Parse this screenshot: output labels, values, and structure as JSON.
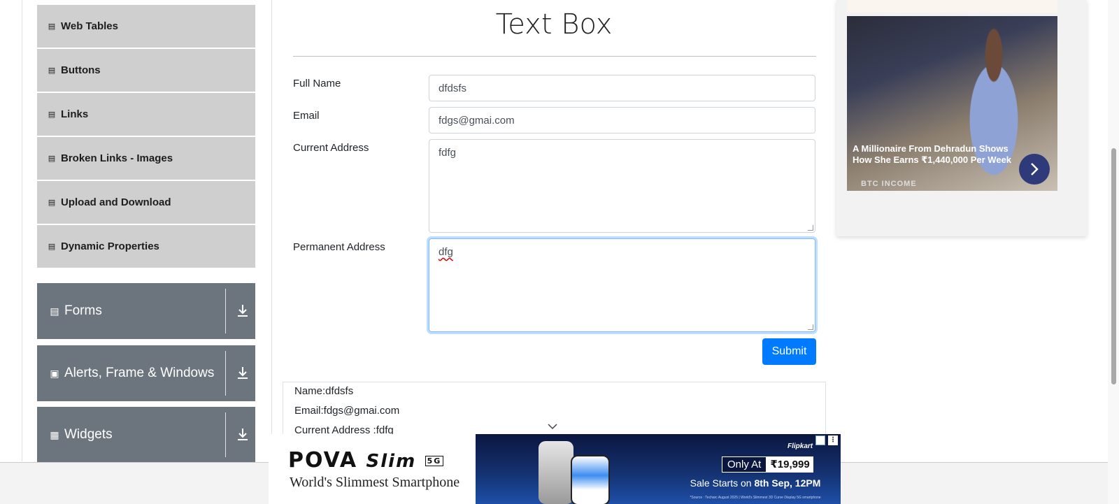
{
  "sidebar": {
    "items": [
      {
        "label": "Web Tables",
        "icon": "element-icon"
      },
      {
        "label": "Buttons",
        "icon": "element-icon"
      },
      {
        "label": "Links",
        "icon": "element-icon"
      },
      {
        "label": "Broken Links - Images",
        "icon": "element-icon"
      },
      {
        "label": "Upload and Download",
        "icon": "element-icon"
      },
      {
        "label": "Dynamic Properties",
        "icon": "element-icon"
      }
    ],
    "groups": [
      {
        "label": "Forms",
        "icon": "document-icon"
      },
      {
        "label": "Alerts, Frame & Windows",
        "icon": "window-icon"
      },
      {
        "label": "Widgets",
        "icon": "grid-icon"
      }
    ]
  },
  "main": {
    "title": "Text Box",
    "form": {
      "full_name_label": "Full Name",
      "full_name_value": "dfdsfs",
      "email_label": "Email",
      "email_value": "fdgs@gmai.com",
      "current_address_label": "Current Address",
      "current_address_value": "fdfg",
      "permanent_address_label": "Permanent Address",
      "permanent_address_value": "dfg",
      "submit_label": "Submit"
    },
    "output": {
      "name": "Name:dfdsfs",
      "email": "Email:fdgs@gmai.com",
      "current_address": "Current Address :fdfg"
    }
  },
  "right_ad": {
    "caption": "A Millionaire From Dehradun Shows How She Earns ₹1,440,000 Per Week",
    "source": "BTC INCOME"
  },
  "bottom_ad": {
    "brand": "POVA",
    "model": "Slim",
    "badge": "5G",
    "slogan": "World's Slimmest Smartphone",
    "only_at": "Only At",
    "price": "₹19,999",
    "sale_prefix": "Sale Starts on ",
    "sale_date": "8th Sep, 12PM",
    "retailer": "Flipkart",
    "fine_print": "*Source : Techarc August 2025 | World's Slimmest 3D Curve Display 5G smartphone"
  },
  "colors": {
    "accent": "#007bff",
    "sidebar_item_bg": "#cfcfcf",
    "sidebar_group_bg": "#6c757d"
  }
}
